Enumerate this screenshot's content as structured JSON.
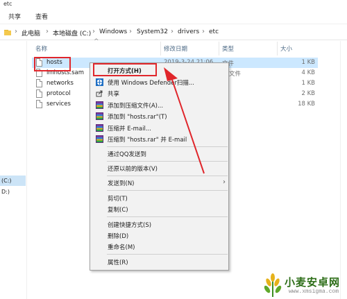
{
  "window": {
    "title": "etc"
  },
  "ribbon": {
    "tabs": [
      "共享",
      "查看"
    ]
  },
  "address": {
    "crumbs": [
      "此电脑",
      "本地磁盘 (C:)",
      "Windows",
      "System32",
      "drivers",
      "etc"
    ]
  },
  "nav": {
    "drive_c": "(C:)",
    "drive_d": "D:)"
  },
  "columns": {
    "name": "名称",
    "date": "修改日期",
    "type": "类型",
    "size": "大小"
  },
  "files": [
    {
      "name": "hosts",
      "date": "2019-3-24 21:06",
      "type": "文件",
      "size": "1 KB",
      "selected": true
    },
    {
      "name": "lmhosts.sam",
      "date": "",
      "type": "M 文件",
      "size": "4 KB",
      "selected": false
    },
    {
      "name": "networks",
      "date": "",
      "type": "",
      "size": "1 KB",
      "selected": false
    },
    {
      "name": "protocol",
      "date": "",
      "type": "",
      "size": "2 KB",
      "selected": false
    },
    {
      "name": "services",
      "date": "",
      "type": "",
      "size": "18 KB",
      "selected": false
    }
  ],
  "context_menu": {
    "open_with": "打开方式(H)",
    "defender": "使用 Windows Defender扫描...",
    "share": "共享",
    "add_archive": "添加到压缩文件(A)...",
    "add_rar": "添加到 \"hosts.rar\"(T)",
    "zip_email": "压缩并 E-mail...",
    "zip_rar_email": "压缩到 \"hosts.rar\" 并 E-mail",
    "qq_send": "通过QQ发送到",
    "restore": "还原以前的版本(V)",
    "send_to": "发送到(N)",
    "cut": "剪切(T)",
    "copy": "复制(C)",
    "shortcut": "创建快捷方式(S)",
    "delete": "删除(D)",
    "rename": "重命名(M)",
    "properties": "属性(R)"
  },
  "watermark": {
    "name": "小麦安卓网",
    "url": "www.xmsigma.com"
  },
  "colors": {
    "highlight": "#e0262b",
    "selection": "#cce8ff",
    "accent_green": "#2c6d17"
  }
}
